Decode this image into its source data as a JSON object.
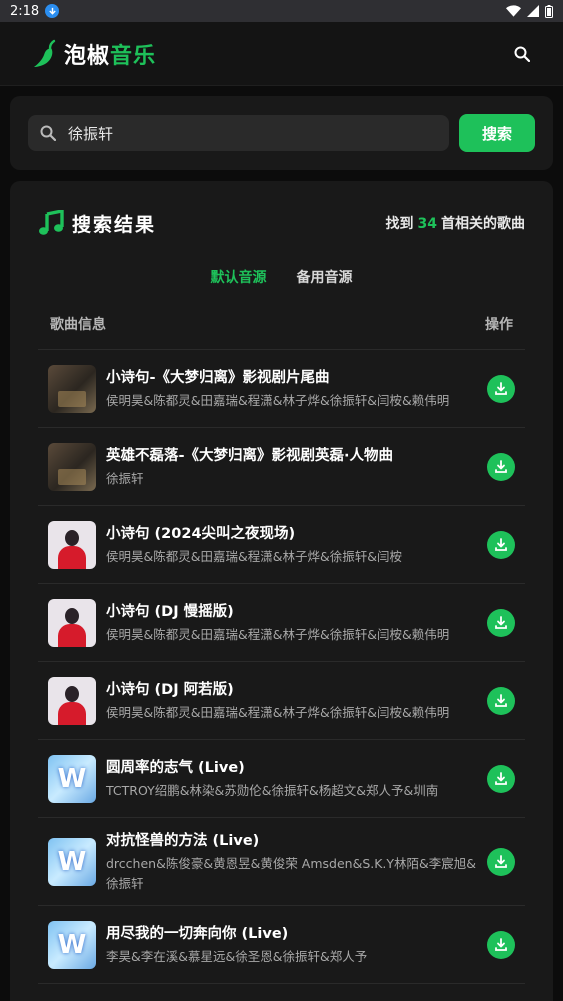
{
  "status_bar": {
    "time": "2:18"
  },
  "app": {
    "name_part1": "泡椒",
    "name_part2": "音乐"
  },
  "search": {
    "value": "徐振轩",
    "button_label": "搜索"
  },
  "results": {
    "title": "搜索结果",
    "count_prefix": "找到",
    "count": "34",
    "count_suffix": "首相关的歌曲",
    "tabs": [
      {
        "label": "默认音源",
        "active": true
      },
      {
        "label": "备用音源",
        "active": false
      }
    ],
    "columns": {
      "info": "歌曲信息",
      "action": "操作"
    },
    "songs": [
      {
        "title": "小诗句-《大梦归离》影视剧片尾曲",
        "artist": "侯明昊&陈都灵&田嘉瑞&程潇&林子烨&徐振轩&闫桉&赖伟明",
        "cover": "drama"
      },
      {
        "title": "英雄不磊落-《大梦归离》影视剧英磊·人物曲",
        "artist": "徐振轩",
        "cover": "drama"
      },
      {
        "title": "小诗句 (2024尖叫之夜现场)",
        "artist": "侯明昊&陈都灵&田嘉瑞&程潇&林子烨&徐振轩&闫桉",
        "cover": "person"
      },
      {
        "title": "小诗句 (DJ 慢摇版)",
        "artist": "侯明昊&陈都灵&田嘉瑞&程潇&林子烨&徐振轩&闫桉&赖伟明",
        "cover": "person"
      },
      {
        "title": "小诗句 (DJ 阿若版)",
        "artist": "侯明昊&陈都灵&田嘉瑞&程潇&林子烨&徐振轩&闫桉&赖伟明",
        "cover": "person"
      },
      {
        "title": "圆周率的志气 (Live)",
        "artist": "TCTROY绍鹏&林染&苏勋伦&徐振轩&杨超文&郑人予&圳南",
        "cover": "live"
      },
      {
        "title": "对抗怪兽的方法 (Live)",
        "artist": "drcchen&陈俊豪&黄恩昱&黄俊荣 Amsden&S.K.Y林陌&李宸旭&徐振轩",
        "cover": "live"
      },
      {
        "title": "用尽我的一切奔向你 (Live)",
        "artist": "李昊&李在溪&慕星远&徐圣恩&徐振轩&郑人予",
        "cover": "live"
      }
    ]
  },
  "colors": {
    "accent": "#1ec15a",
    "background": "#0c0c0c",
    "card": "#191919"
  }
}
